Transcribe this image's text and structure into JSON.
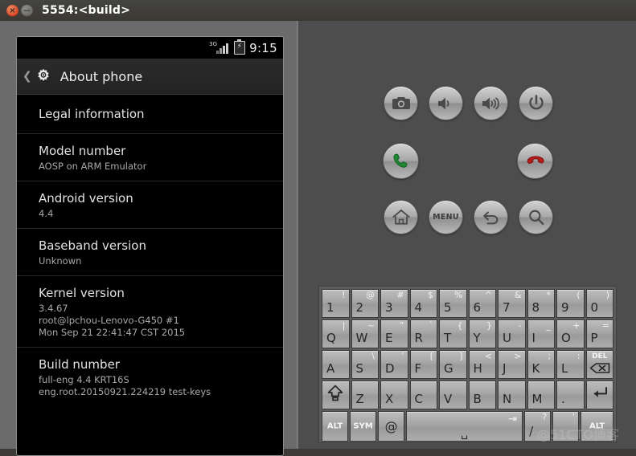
{
  "window": {
    "title": "5554:<build>",
    "close_label": "×",
    "minimize_label": "−"
  },
  "phone": {
    "status_bar": {
      "network": "3G",
      "time": "9:15",
      "battery_icon": "battery-charging-icon"
    },
    "action_bar": {
      "back_icon": "chevron-left-icon",
      "app_icon": "settings-gear-icon",
      "title": "About phone"
    },
    "items": [
      {
        "title": "Legal information",
        "subtitle": ""
      },
      {
        "title": "Model number",
        "subtitle": "AOSP on ARM Emulator"
      },
      {
        "title": "Android version",
        "subtitle": "4.4"
      },
      {
        "title": "Baseband version",
        "subtitle": "Unknown"
      },
      {
        "title": "Kernel version",
        "subtitle": "3.4.67\nroot@lpchou-Lenovo-G450 #1\nMon Sep 21 22:41:47 CST 2015"
      },
      {
        "title": "Build number",
        "subtitle": "full-eng 4.4 KRT16S\neng.root.20150921.224219 test-keys"
      }
    ]
  },
  "controls": {
    "row1": [
      {
        "name": "camera-button",
        "icon": "camera-icon"
      },
      {
        "name": "volume-down-button",
        "icon": "volume-low-icon"
      },
      {
        "name": "volume-up-button",
        "icon": "volume-high-icon"
      },
      {
        "name": "power-button",
        "icon": "power-icon"
      }
    ],
    "row2": [
      {
        "name": "call-button",
        "icon": "phone-call-icon"
      },
      {
        "name": "end-call-button",
        "icon": "phone-hangup-icon"
      }
    ],
    "dpad": {
      "name": "dpad",
      "up": "▲",
      "down": "▼",
      "left": "◀",
      "right": "▶",
      "center_name": "dpad-center-button"
    },
    "row3": [
      {
        "name": "home-button",
        "icon": "home-icon",
        "label": ""
      },
      {
        "name": "menu-button",
        "icon": "menu-icon",
        "label": "MENU"
      },
      {
        "name": "back-button",
        "icon": "back-arrow-icon",
        "label": ""
      },
      {
        "name": "search-button",
        "icon": "magnifier-icon",
        "label": ""
      }
    ]
  },
  "keyboard": {
    "rows": [
      [
        {
          "main": "1",
          "sec": "!"
        },
        {
          "main": "2",
          "sec": "@"
        },
        {
          "main": "3",
          "sec": "#"
        },
        {
          "main": "4",
          "sec": "$"
        },
        {
          "main": "5",
          "sec": "%"
        },
        {
          "main": "6",
          "sec": "^"
        },
        {
          "main": "7",
          "sec": "&"
        },
        {
          "main": "8",
          "sec": "*"
        },
        {
          "main": "9",
          "sec": "("
        },
        {
          "main": "0",
          "sec": ")"
        }
      ],
      [
        {
          "main": "Q",
          "sec": "|"
        },
        {
          "main": "W",
          "sec": "~"
        },
        {
          "main": "E",
          "sec": "”"
        },
        {
          "main": "R",
          "sec": "`"
        },
        {
          "main": "T",
          "sec": "{"
        },
        {
          "main": "Y",
          "sec": "}"
        },
        {
          "main": "U",
          "sec": "-"
        },
        {
          "main": "I",
          "sec": "_"
        },
        {
          "main": "O",
          "sec": "+"
        },
        {
          "main": "P",
          "sec": "="
        }
      ],
      [
        {
          "main": "A",
          "sec": ""
        },
        {
          "main": "S",
          "sec": "\\"
        },
        {
          "main": "D",
          "sec": "’"
        },
        {
          "main": "F",
          "sec": "["
        },
        {
          "main": "G",
          "sec": "]"
        },
        {
          "main": "H",
          "sec": "<"
        },
        {
          "main": "J",
          "sec": ">"
        },
        {
          "main": "K",
          "sec": ";"
        },
        {
          "main": "L",
          "sec": ":"
        },
        {
          "main": "DEL",
          "sec": "",
          "type": "delete"
        }
      ],
      [
        {
          "main": "",
          "sec": "",
          "type": "shift"
        },
        {
          "main": "Z",
          "sec": ""
        },
        {
          "main": "X",
          "sec": ""
        },
        {
          "main": "C",
          "sec": ""
        },
        {
          "main": "V",
          "sec": ""
        },
        {
          "main": "B",
          "sec": ""
        },
        {
          "main": "N",
          "sec": ""
        },
        {
          "main": "M",
          "sec": ""
        },
        {
          "main": ".",
          "sec": ""
        },
        {
          "main": "",
          "sec": "",
          "type": "enter"
        }
      ],
      [
        {
          "main": "ALT",
          "sec": "",
          "type": "label"
        },
        {
          "main": "SYM",
          "sec": "",
          "type": "label"
        },
        {
          "main": "@",
          "sec": "",
          "type": "center"
        },
        {
          "main": "",
          "sec": "",
          "type": "space"
        },
        {
          "main": "/",
          "sec": "?"
        },
        {
          "main": "",
          "sec": "’"
        },
        {
          "main": "ALT",
          "sec": "",
          "type": "label"
        }
      ]
    ]
  },
  "watermark": "@51CTO博客"
}
